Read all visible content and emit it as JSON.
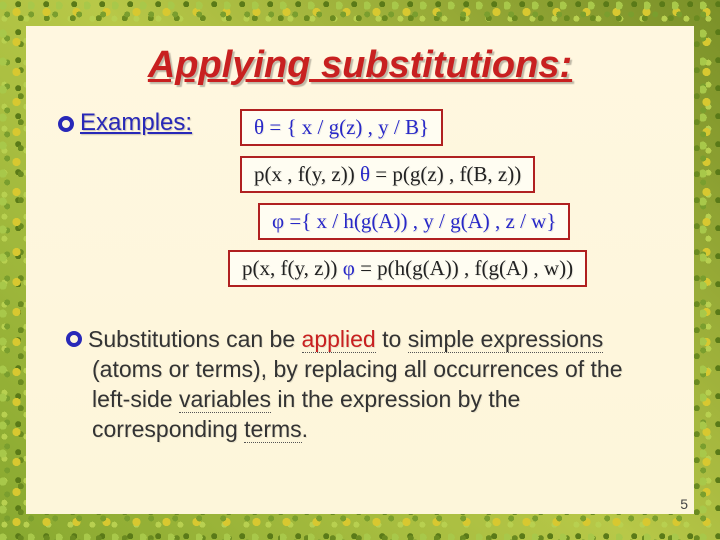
{
  "title": "Applying substitutions:",
  "examples_label": "Examples:",
  "theta_def": "θ = { x / g(z) , y / B}",
  "theta_apply_lhs": "p(x , f(y, z)) ",
  "theta_apply_mid": "θ",
  "theta_apply_rhs": " = p(g(z) , f(B, z))",
  "phi_def": "φ ={ x / h(g(A)) , y / g(A) , z / w}",
  "phi_apply_lhs": "p(x, f(y, z)) ",
  "phi_apply_mid": "φ",
  "phi_apply_rhs": " = p(h(g(A)) , f(g(A) , w))",
  "body": {
    "pre": "Substitutions can be ",
    "applied": "applied",
    "mid1": " to ",
    "simple_expr": "simple expressions",
    "mid2": " (atoms or terms), by replacing all occurrences of the left-side ",
    "variables": "variables",
    "mid3": " in the expression by the corresponding ",
    "terms": "terms",
    "end": "."
  },
  "slide_number": "5"
}
